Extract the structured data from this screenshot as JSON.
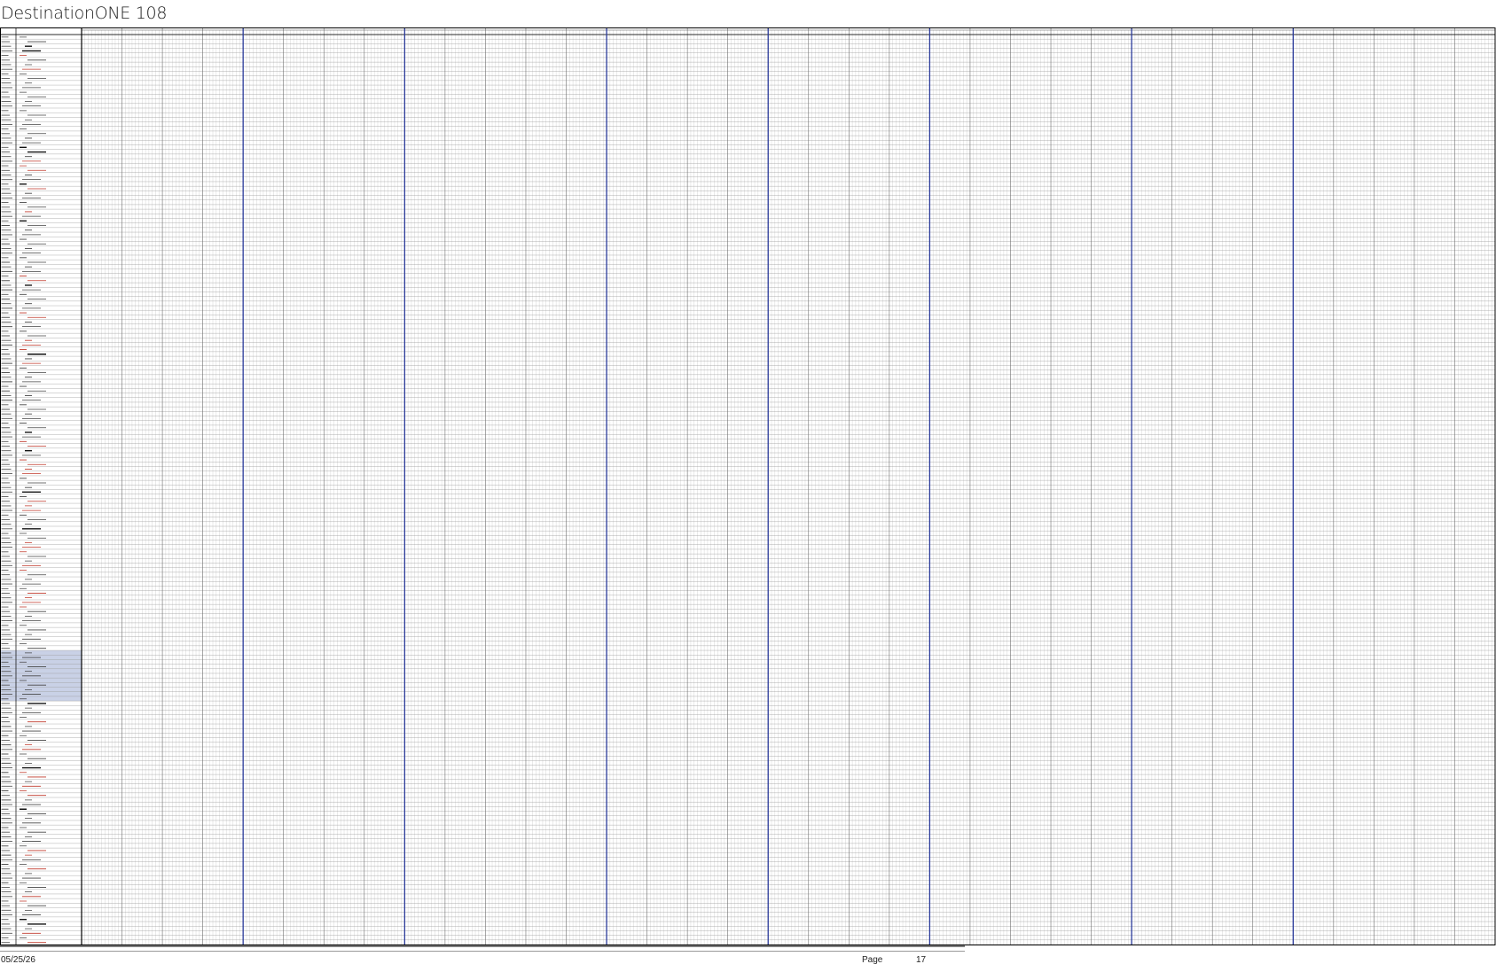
{
  "document": {
    "title": "DestinationONE 108",
    "footer": {
      "date": "05/25/26",
      "page_label": "Page",
      "page_number": "17"
    }
  },
  "sheet": {
    "row_count": 198,
    "block_count": 35,
    "fine_cells_per_block": 12,
    "major_divider_blocks": [
      4,
      8,
      13,
      17,
      21,
      26,
      30
    ],
    "colors": {
      "major_divider": "#2a3a9a",
      "grid_line": "#c4c4c4",
      "frame": "#000000",
      "selection_fill": "#c9d1e6",
      "red_label": "#c0392b",
      "dark_label": "#444444"
    },
    "selected_rows": [
      134,
      135,
      136,
      137,
      138,
      139,
      140,
      141,
      142,
      143,
      144
    ],
    "row_label_styles": [
      "dark",
      "dark",
      "bold",
      "bold",
      "red",
      "dark",
      "dark",
      "red",
      "dark",
      "dark",
      "dark",
      "dark",
      "dark",
      "dark",
      "dark",
      "dark",
      "dark",
      "dark",
      "dark",
      "dark",
      "dark",
      "dark",
      "dark",
      "dark",
      "bold",
      "bold",
      "dark",
      "red",
      "red",
      "red",
      "dark",
      "dark",
      "bold",
      "red",
      "dark",
      "dark",
      "dark",
      "dark",
      "red",
      "dark",
      "bold",
      "dark",
      "dark",
      "dark",
      "dark",
      "dark",
      "dark",
      "dark",
      "dark",
      "dark",
      "dark",
      "dark",
      "red",
      "red",
      "bold",
      "dark",
      "dark",
      "dark",
      "dark",
      "dark",
      "red",
      "red",
      "dark",
      "dark",
      "dark",
      "dark",
      "red",
      "red",
      "red",
      "bold",
      "dark",
      "red",
      "dark",
      "dark",
      "dark",
      "dark",
      "dark",
      "dark",
      "dark",
      "dark",
      "dark",
      "dark",
      "dark",
      "dark",
      "dark",
      "dark",
      "bold",
      "dark",
      "red",
      "red",
      "bold",
      "dark",
      "red",
      "red",
      "red",
      "red",
      "dark",
      "dark",
      "dark",
      "bold",
      "dark",
      "red",
      "red",
      "red",
      "dark",
      "dark",
      "dark",
      "bold",
      "dark",
      "dark",
      "red",
      "red",
      "red",
      "dark",
      "dark",
      "red",
      "red",
      "dark",
      "dark",
      "dark",
      "dark",
      "red",
      "red",
      "red",
      "red",
      "dark",
      "dark",
      "dark",
      "dark",
      "dark",
      "dark",
      "dark",
      "dark",
      "dark",
      "dark",
      "dark",
      "dark",
      "dark",
      "dark",
      "dark",
      "dark",
      "dark",
      "dark",
      "dark",
      "dark",
      "bold",
      "dark",
      "dark",
      "dark",
      "red",
      "dark",
      "dark",
      "dark",
      "dark",
      "red",
      "red",
      "dark",
      "dark",
      "dark",
      "bold",
      "red",
      "red",
      "dark",
      "red",
      "red",
      "red",
      "dark",
      "dark",
      "bold",
      "dark",
      "dark",
      "dark",
      "dark",
      "dark",
      "dark",
      "dark",
      "dark",
      "red",
      "red",
      "dark",
      "dark",
      "red",
      "dark",
      "dark",
      "dark",
      "dark",
      "dark",
      "red",
      "red",
      "dark",
      "dark",
      "dark",
      "bold",
      "bold",
      "dark",
      "red",
      "dark",
      "red",
      "dark",
      "dark"
    ]
  }
}
